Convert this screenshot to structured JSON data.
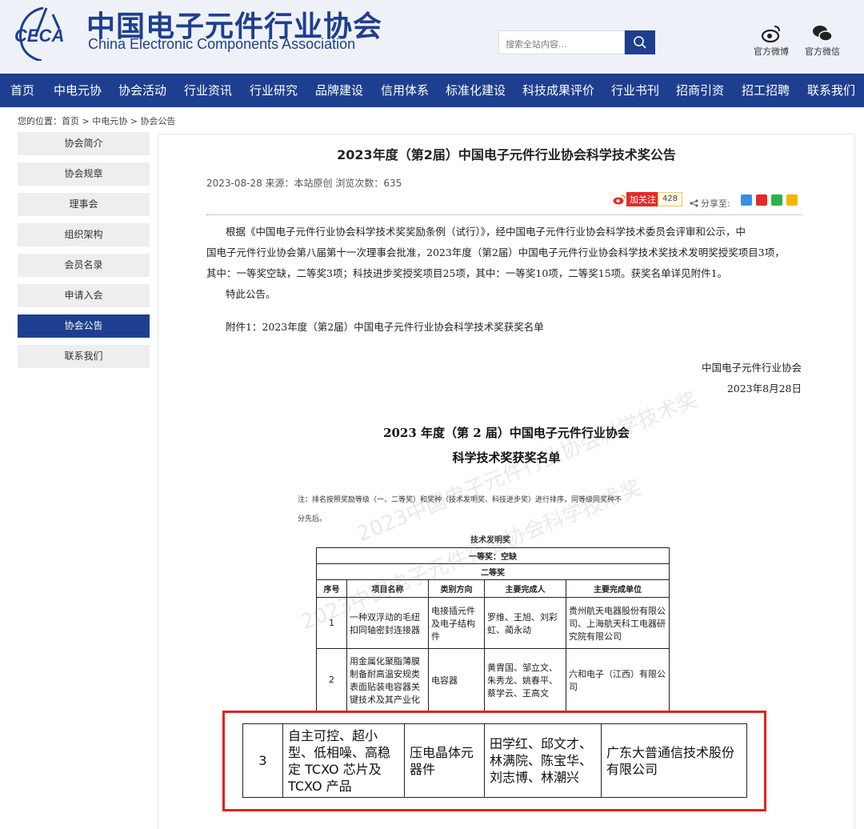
{
  "site": {
    "name_cn": "中国电子元件行业协会",
    "name_en": "China Electronic Components Association",
    "logo_text": "CECA"
  },
  "search": {
    "placeholder": "搜索全站内容..."
  },
  "social": {
    "weibo": "官方微博",
    "wechat": "官方微信"
  },
  "nav": [
    "首页",
    "中电元协",
    "协会活动",
    "行业资讯",
    "行业研究",
    "品牌建设",
    "信用体系",
    "标准化建设",
    "科技成果评价",
    "行业书刊",
    "招商引资",
    "招工招聘",
    "联系我们"
  ],
  "breadcrumb": "您的位置：首页 > 中电元协 > 协会公告",
  "sidebar": [
    "协会简介",
    "协会规章",
    "理事会",
    "组织架构",
    "会员名录",
    "申请入会",
    "协会公告",
    "联系我们"
  ],
  "sidebar_active": "协会公告",
  "article": {
    "title": "2023年度（第2届）中国电子元件行业协会科学技术奖公告",
    "meta": "2023-08-28   来源：本站原创  浏览次数：635",
    "follow_label": "加关注",
    "follow_count": "428",
    "share_label": "分享至:",
    "body_line1": "根据《中国电子元件行业协会科学技术奖奖励条例（试行）》，经中国电子元件行业协会科学技术委员会评审和公示，中",
    "body_line2": "国电子元件行业协会第八届第十一次理事会批准，2023年度（第2届）中国电子元件行业协会科学技术奖技术发明奖授奖项目3项，",
    "body_line3": "其中：一等奖空缺，二等奖3项；科技进步奖授奖项目25项，其中：一等奖10项，二等奖15项。获奖名单详见附件1。",
    "notice": "特此公告。",
    "attachment": "附件1：2023年度（第2届）中国电子元件行业协会科学技术奖获奖名单",
    "sign_org": "中国电子元件行业协会",
    "sign_date": "2023年8月28日"
  },
  "document": {
    "title_line1": "2023 年度（第 2 届）中国电子元件行业协会",
    "title_line2": "科学技术奖获奖名单",
    "note_line1": "注：排名按照奖励等级（一、二等奖）和奖种（技术发明奖、科技进步奖）进行排序，同等级同奖种不",
    "note_line2": "分先后。",
    "section": "技术发明奖",
    "first_prize": "一等奖：空缺",
    "second_prize": "二等奖",
    "headers": [
      "序号",
      "项目名称",
      "类别方向",
      "主要完成人",
      "主要完成单位"
    ],
    "rows": [
      [
        "1",
        "一种双浮动的毛纽扣同轴密封连接器",
        "电接插元件及电子结构件",
        "罗维、王旭、刘彩虹、蔺永动",
        "贵州航天电器股份有限公司、上海航天科工电器研究院有限公司"
      ],
      [
        "2",
        "用金属化聚脂薄膜制备耐高温安规类表面贴装电容器关键技术及其产业化",
        "电容器",
        "黄胄国、邹立文、朱秀龙、姚春平、蔡学云、王高文",
        "六和电子（江西）有限公司"
      ]
    ],
    "highlight_row": [
      "3",
      "自主可控、超小型、低相噪、高稳定 TCXO 芯片及 TCXO 产品",
      "压电晶体元器件",
      "田学红、邱文才、林满院、陈宝华、刘志博、林潮兴",
      "广东大普通信技术股份有限公司"
    ],
    "watermark": "2023中国电子元件行业协会科学技术奖"
  },
  "colors": {
    "brand": "#1e3f8f",
    "highlight": "#e2211c",
    "weibo": "#e42a2a"
  }
}
